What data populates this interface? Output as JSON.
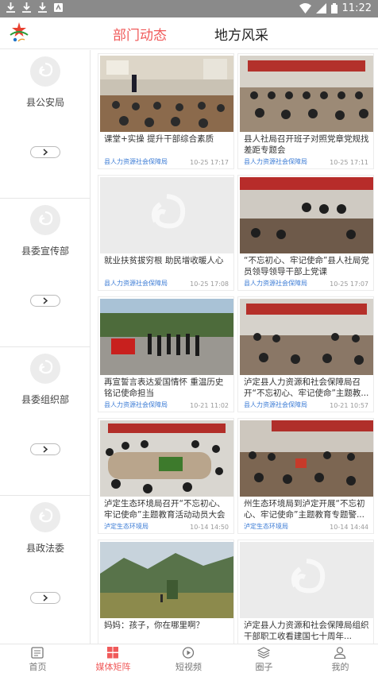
{
  "status_bar": {
    "time": "11:22",
    "icons": [
      "download-icon",
      "download-icon",
      "download-icon",
      "app-icon",
      "wifi-icon",
      "signal-icon",
      "battery-icon"
    ]
  },
  "header": {
    "tabs": [
      {
        "label": "部门动态",
        "active": true
      },
      {
        "label": "地方风采",
        "active": false
      }
    ],
    "accent_color": "#f05a5a"
  },
  "sidebar": {
    "departments": [
      {
        "name": "县公安局"
      },
      {
        "name": "县委宣传部"
      },
      {
        "name": "县委组织部"
      },
      {
        "name": "县政法委"
      }
    ]
  },
  "articles": [
    {
      "title": "课堂+实操 提升干部综合素质",
      "source": "县人力资源社会保障局",
      "time": "10-25 17:17",
      "image": "meeting-room-photo"
    },
    {
      "title": "县人社局召开班子对照党章党规找差距专题会",
      "source": "县人力资源社会保障局",
      "time": "10-25 17:11",
      "image": "conference-photo"
    },
    {
      "title": "就业扶贫拔穷根 助民增收暖人心",
      "source": "县人力资源社会保障局",
      "time": "10-25 17:08",
      "image": "placeholder-logo"
    },
    {
      "title": "“不忘初心、牢记使命”县人社局党员领导领导干部上党课",
      "source": "县人力资源社会保障局",
      "time": "10-25 17:07",
      "image": "stage-lecture-photo"
    },
    {
      "title": "再宣誓言表达爱国情怀 重温历史铭记使命担当",
      "source": "县人力资源社会保障局",
      "time": "10-21 11:02",
      "image": "party-flag-oath-photo"
    },
    {
      "title": "泸定县人力资源和社会保障局召开“不忘初心、牢记使命”主题教...",
      "source": "县人力资源社会保障局",
      "time": "10-21 10:57",
      "image": "meeting-banner-photo"
    },
    {
      "title": "泸定生态环境局召开“不忘初心、牢记使命”主题教育活动动员大会",
      "source": "泸定生态环境局",
      "time": "10-14 14:50",
      "image": "round-table-photo"
    },
    {
      "title": "州生态环境局到泸定开展“不忘初心、牢记使命”主题教育专题警...",
      "source": "泸定生态环境局",
      "time": "10-14 14:44",
      "image": "meeting-red-banner-photo"
    },
    {
      "title": "妈妈：孩子，你在哪里啊？",
      "source": "",
      "time": "",
      "image": "mountain-landscape-photo"
    },
    {
      "title": "泸定县人力资源和社会保障局组织干部职工收看建国七十周年...",
      "source": "",
      "time": "",
      "image": "placeholder-logo"
    }
  ],
  "bottom_nav": [
    {
      "label": "首页",
      "icon": "home-icon",
      "active": false
    },
    {
      "label": "媒体矩阵",
      "icon": "grid-icon",
      "active": true
    },
    {
      "label": "短视频",
      "icon": "play-icon",
      "active": false
    },
    {
      "label": "圈子",
      "icon": "layers-icon",
      "active": false
    },
    {
      "label": "我的",
      "icon": "user-icon",
      "active": false
    }
  ]
}
